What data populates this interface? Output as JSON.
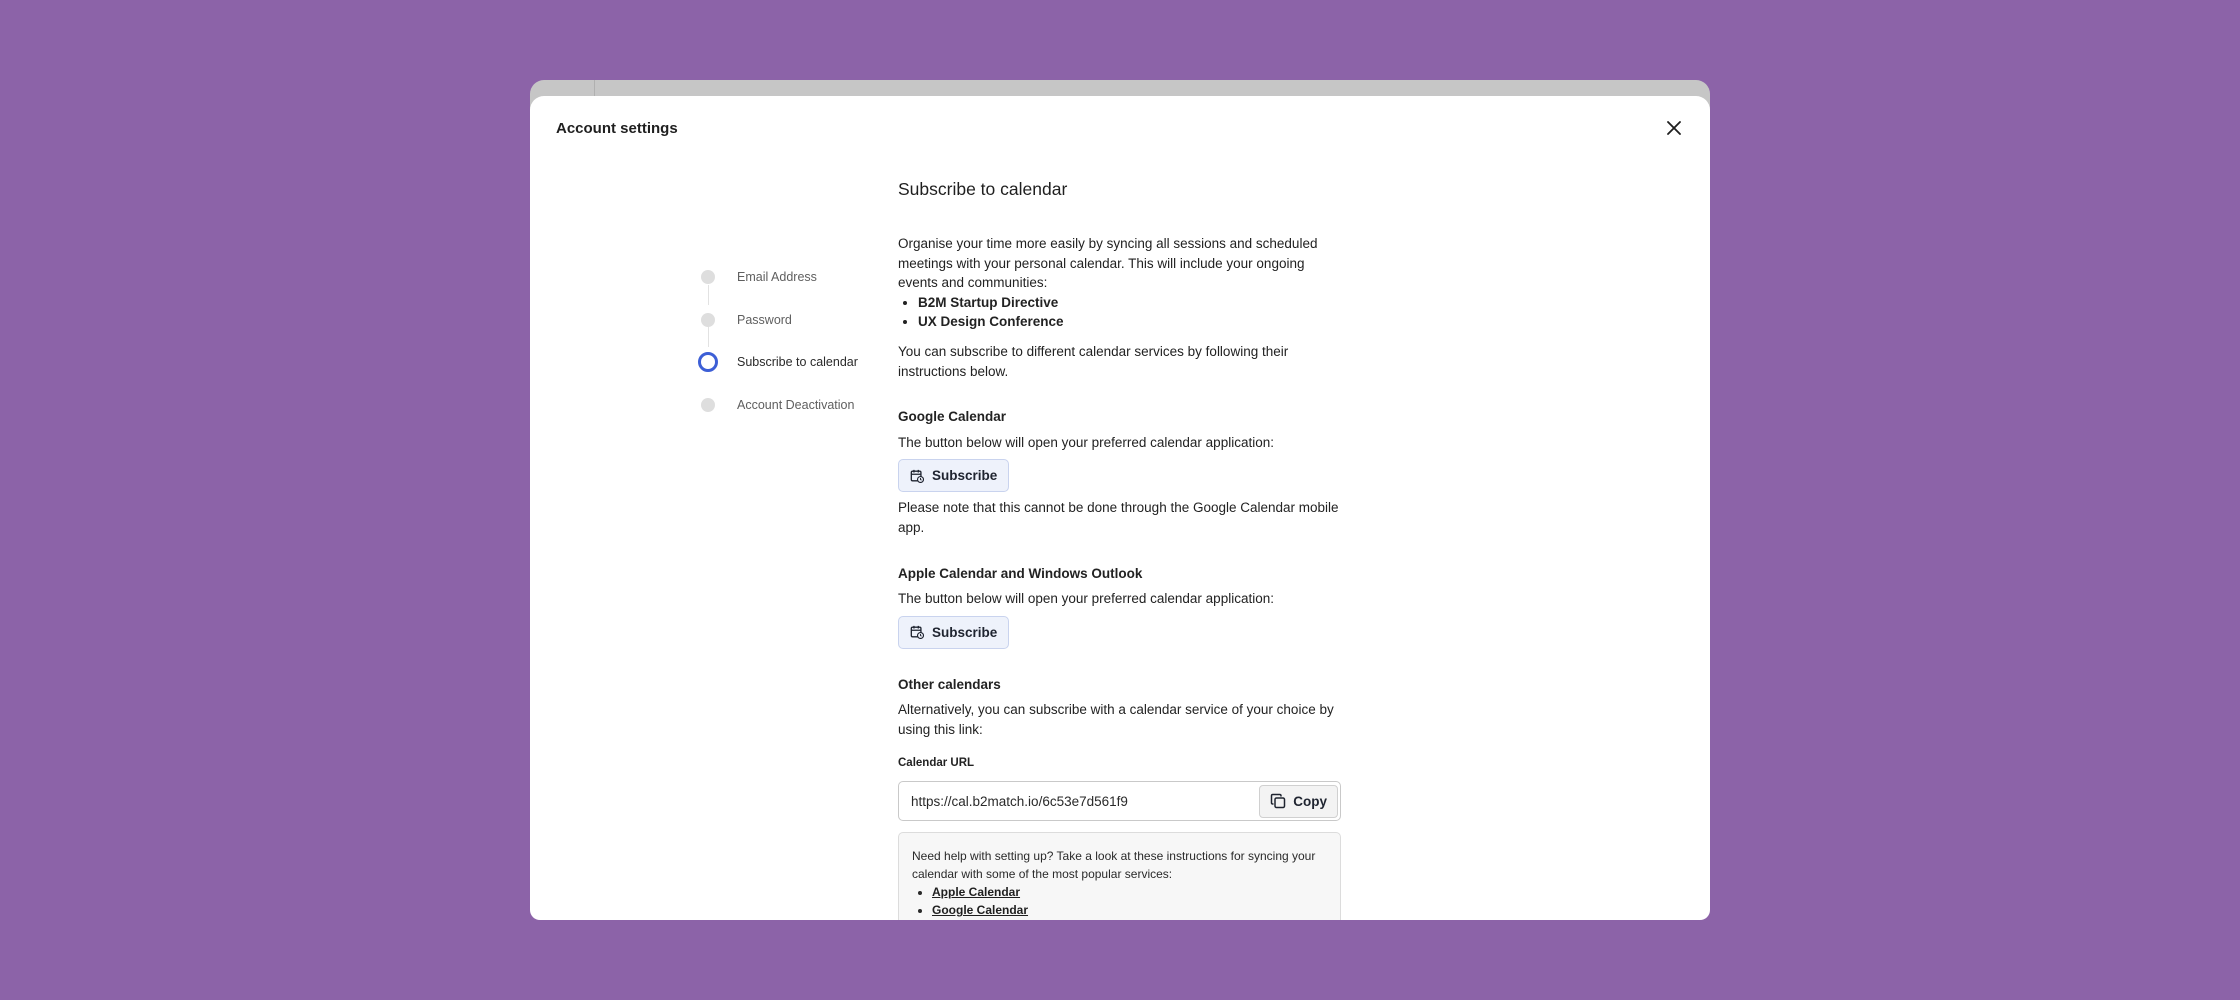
{
  "modal": {
    "title": "Account settings",
    "close_icon": "close-icon"
  },
  "stepper": {
    "items": [
      {
        "label": "Email Address",
        "state": "inactive"
      },
      {
        "label": "Password",
        "state": "inactive"
      },
      {
        "label": "Subscribe to calendar",
        "state": "active"
      },
      {
        "label": "Account Deactivation",
        "state": "inactive"
      }
    ],
    "active_color": "#3d5fd6"
  },
  "content": {
    "title": "Subscribe to calendar",
    "intro": "Organise your time more easily by syncing all sessions and scheduled meetings with your personal calendar. This will include your ongoing events and communities:",
    "events": [
      "B2M Startup Directive",
      "UX Design Conference"
    ],
    "intro2": "You can subscribe to different calendar services by following their instructions below.",
    "google": {
      "title": "Google Calendar",
      "desc": "The button below will open your preferred calendar application:",
      "button": "Subscribe",
      "note": "Please note that this cannot be done through the Google Calendar mobile app."
    },
    "apple": {
      "title": "Apple Calendar and Windows Outlook",
      "desc": "The button below will open your preferred calendar application:",
      "button": "Subscribe"
    },
    "other": {
      "title": "Other calendars",
      "desc": "Alternatively, you can subscribe with a calendar service of your choice by using this link:",
      "url_label": "Calendar URL",
      "url_value": "https://cal.b2match.io/6c53e7d561f9",
      "copy_label": "Copy"
    },
    "help": {
      "text": "Need help with setting up? Take a look at these instructions for syncing your calendar with some of the most popular services:",
      "links": [
        "Apple Calendar",
        "Google Calendar"
      ]
    }
  },
  "colors": {
    "background": "#8c63a8",
    "accent": "#3d5fd6"
  }
}
